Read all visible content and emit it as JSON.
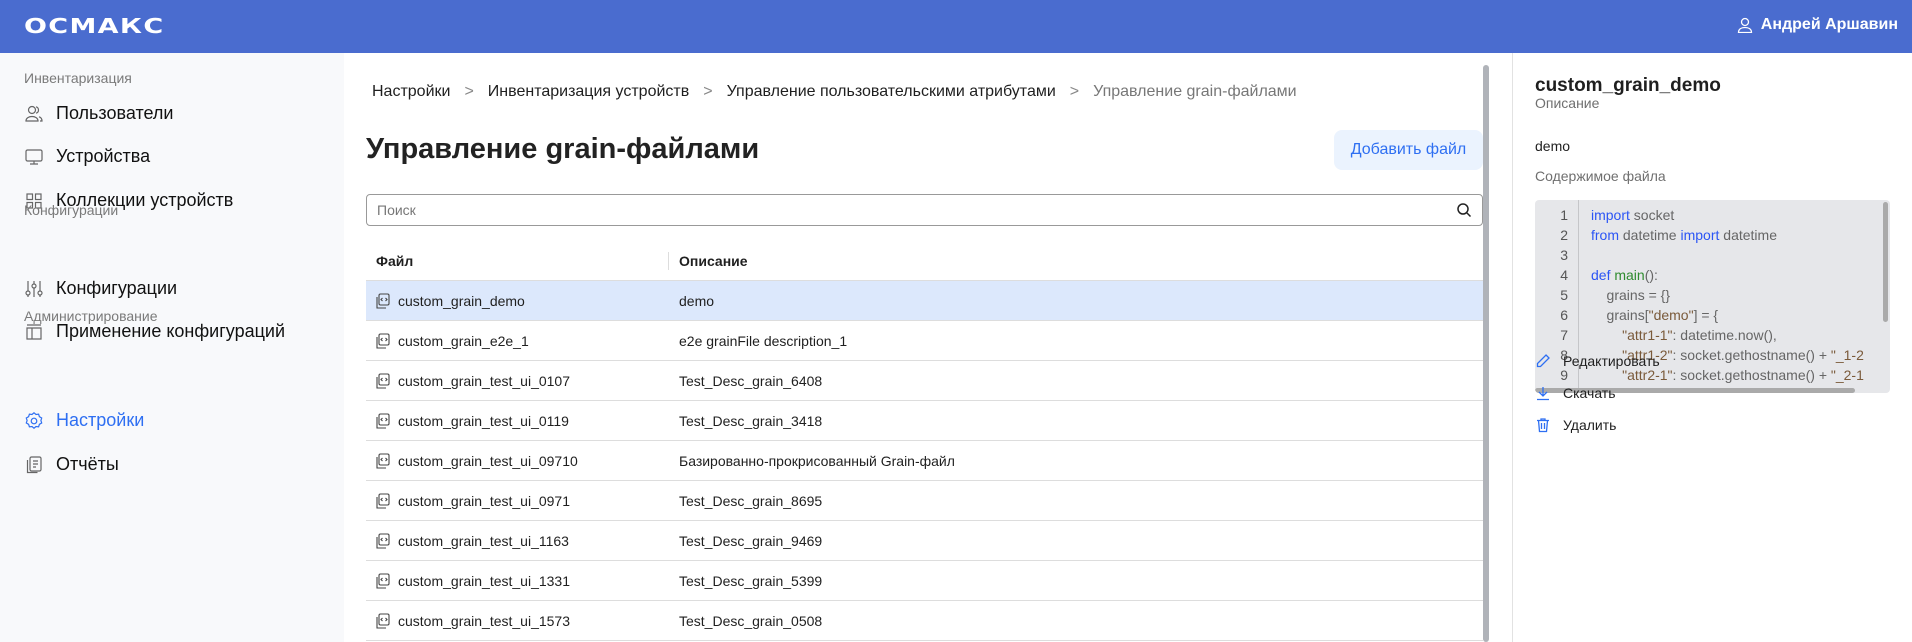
{
  "header": {
    "logo": "ОСМАКС",
    "user_name": "Андрей Аршавин",
    "bg_color": "#4a6ccf"
  },
  "sidebar": {
    "sections": [
      {
        "title": "Инвентаризация",
        "items": [
          {
            "label": "Пользователи",
            "icon": "users-icon"
          },
          {
            "label": "Устройства",
            "icon": "monitor-icon"
          },
          {
            "label": "Коллекции устройств",
            "icon": "grid-icon"
          }
        ]
      },
      {
        "title": "Конфигурации",
        "items": [
          {
            "label": "Конфигурации",
            "icon": "sliders-icon"
          },
          {
            "label": "Применение конфигураций",
            "icon": "layout-icon"
          }
        ]
      },
      {
        "title": "Администрирование",
        "items": [
          {
            "label": "Настройки",
            "icon": "gear-icon",
            "active": true
          },
          {
            "label": "Отчёты",
            "icon": "reports-icon"
          }
        ]
      }
    ]
  },
  "main": {
    "breadcrumbs": [
      "Настройки",
      "Инвентаризация устройств",
      "Управление пользовательскими атрибутами",
      "Управление grain-файлами"
    ],
    "title": "Управление grain-файлами",
    "add_button": "Добавить файл",
    "search_placeholder": "Поиск",
    "columns": [
      "Файл",
      "Описание"
    ],
    "rows": [
      {
        "file": "custom_grain_demo",
        "description": "demo",
        "selected": true
      },
      {
        "file": "custom_grain_e2e_1",
        "description": "e2e grainFile description_1"
      },
      {
        "file": "custom_grain_test_ui_0107",
        "description": "Test_Desc_grain_6408"
      },
      {
        "file": "custom_grain_test_ui_0119",
        "description": "Test_Desc_grain_3418"
      },
      {
        "file": "custom_grain_test_ui_09710",
        "description": "Базированно-прокрисованный Grain-файл"
      },
      {
        "file": "custom_grain_test_ui_0971",
        "description": "Test_Desc_grain_8695"
      },
      {
        "file": "custom_grain_test_ui_1163",
        "description": "Test_Desc_grain_9469"
      },
      {
        "file": "custom_grain_test_ui_1331",
        "description": "Test_Desc_grain_5399"
      },
      {
        "file": "custom_grain_test_ui_1573",
        "description": "Test_Desc_grain_0508"
      }
    ]
  },
  "panel": {
    "title": "custom_grain_demo",
    "description_label": "Описание",
    "description": "demo",
    "content_label": "Содержимое файла",
    "code_lines": [
      "import socket",
      "from datetime import datetime",
      "",
      "def main():",
      "    grains = {}",
      "    grains[\"demo\"] = {",
      "        \"attr1-1\": datetime.now(),",
      "        \"attr1-2\": socket.gethostname() + \"_1-2",
      "        \"attr2-1\": socket.gethostname() + \"_2-1"
    ],
    "actions": {
      "edit": "Редактировать",
      "download": "Скачать",
      "delete": "Удалить"
    }
  }
}
